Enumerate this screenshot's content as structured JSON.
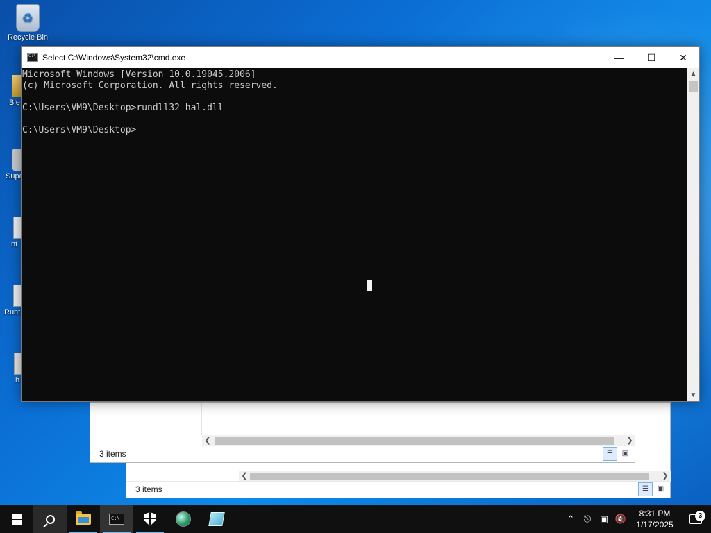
{
  "desktop": {
    "icons": [
      {
        "label": "Recycle Bin"
      },
      {
        "label": "Ble"
      },
      {
        "label": "Supe"
      },
      {
        "label": "nt"
      },
      {
        "label": "Runt"
      },
      {
        "label": "h"
      }
    ]
  },
  "explorer_back": {
    "status": "3 items"
  },
  "explorer_front": {
    "status": "3 items"
  },
  "cmd_window": {
    "title": "Select C:\\Windows\\System32\\cmd.exe",
    "minimize_glyph": "—",
    "maximize_glyph": "☐",
    "close_glyph": "✕",
    "console_text": "Microsoft Windows [Version 10.0.19045.2006]\n(c) Microsoft Corporation. All rights reserved.\n\nC:\\Users\\VM9\\Desktop>rundll32 hal.dll\n\nC:\\Users\\VM9\\Desktop>"
  },
  "taskbar": {
    "items": [
      {
        "icon": "windows-start-icon"
      },
      {
        "icon": "search-icon"
      },
      {
        "icon": "file-explorer-icon"
      },
      {
        "icon": "command-prompt-icon"
      },
      {
        "icon": "windows-security-icon"
      },
      {
        "icon": "browser-globe-icon"
      },
      {
        "icon": "app-icon"
      }
    ],
    "tray": {
      "chevron": "⌃",
      "time": "8:31 PM",
      "date": "1/17/2025",
      "notification_count": "3"
    }
  }
}
